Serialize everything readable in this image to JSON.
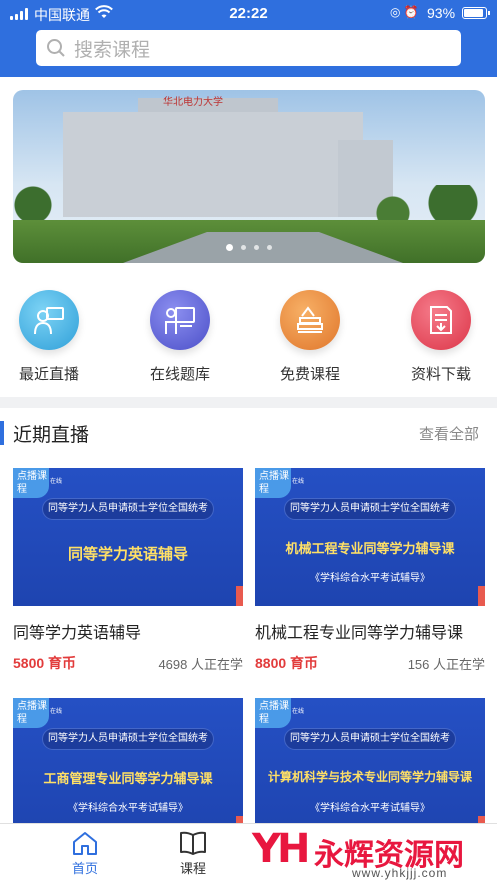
{
  "status_bar": {
    "carrier": "中国联通",
    "time": "22:22",
    "battery": "93%"
  },
  "search": {
    "placeholder": "搜索课程"
  },
  "banner": {
    "sign": "华北电力大学",
    "dots": 4,
    "active_dot": 1
  },
  "categories": [
    {
      "label": "最近直播",
      "icon": "live-teacher-icon",
      "color": "#3aaee0"
    },
    {
      "label": "在线题库",
      "icon": "question-bank-board-icon",
      "color": "#5b5fd6"
    },
    {
      "label": "免费课程",
      "icon": "free-course-books-icon",
      "color": "#ef8a3b"
    },
    {
      "label": "资料下载",
      "icon": "download-document-icon",
      "color": "#e8485a"
    }
  ],
  "section": {
    "title": "近期直播",
    "more": "查看全部"
  },
  "courses": [
    {
      "tag": "点播课程",
      "logo": "在线",
      "header": "同等学力人员申请硕士学位全国统考",
      "main": "同等学力英语辅导",
      "sub": "",
      "title": "同等学力英语辅导",
      "price": "5800 育币",
      "count": "4698 人正在学"
    },
    {
      "tag": "点播课程",
      "logo": "在线",
      "header": "同等学力人员申请硕士学位全国统考",
      "main": "机械工程专业同等学力辅导课",
      "sub": "《学科综合水平考试辅导》",
      "title": "机械工程专业同等学力辅导课",
      "price": "8800 育币",
      "count": "156 人正在学"
    },
    {
      "tag": "点播课程",
      "logo": "在线",
      "header": "同等学力人员申请硕士学位全国统考",
      "main": "工商管理专业同等学力辅导课",
      "sub": "《学科综合水平考试辅导》",
      "title": "",
      "price": "",
      "count": ""
    },
    {
      "tag": "点播课程",
      "logo": "在线",
      "header": "同等学力人员申请硕士学位全国统考",
      "main": "计算机科学与技术专业同等学力辅导课",
      "sub": "《学科综合水平考试辅导》",
      "title": "",
      "price": "",
      "count": ""
    }
  ],
  "tabs": [
    {
      "label": "首页",
      "icon": "home-icon",
      "active": true
    },
    {
      "label": "课程",
      "icon": "book-icon",
      "active": false
    }
  ],
  "watermark": {
    "mark": "YH",
    "name": "永辉资源网",
    "url": "www.yhkjjj.com"
  },
  "colors": {
    "primary": "#2f6fde",
    "price": "#e23b3b",
    "active_tab": "#2f6fde"
  }
}
